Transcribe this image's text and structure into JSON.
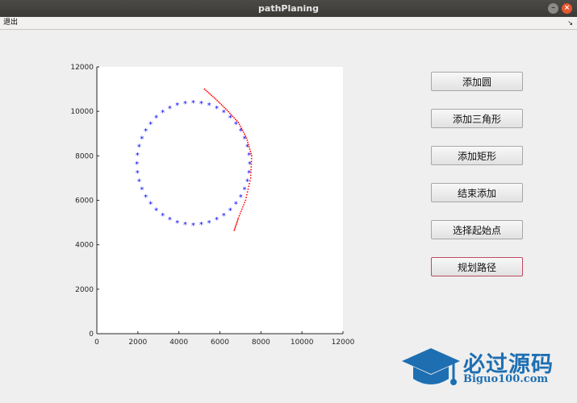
{
  "window": {
    "title": "pathPlaning",
    "close_glyph": "×",
    "min_glyph": "–"
  },
  "menubar": {
    "exit_label": "退出",
    "arrow_glyph": "↘"
  },
  "buttons": {
    "add_circle": "添加圆",
    "add_triangle": "添加三角形",
    "add_rectangle": "添加矩形",
    "finish_add": "结束添加",
    "select_start": "选择起始点",
    "plan_path": "规划路径"
  },
  "chart_data": {
    "type": "scatter",
    "xlim": [
      0,
      12000
    ],
    "ylim": [
      0,
      12000
    ],
    "x_ticks": [
      0,
      2000,
      4000,
      6000,
      8000,
      10000,
      12000
    ],
    "y_ticks": [
      0,
      2000,
      4000,
      6000,
      8000,
      10000,
      12000
    ],
    "grid": false,
    "obstacle_circle": {
      "center": [
        4700,
        7650
      ],
      "radius": 2750,
      "marker": "*",
      "color": "#0000ff",
      "point_count": 44
    },
    "path": {
      "color": "#ff0000",
      "points": [
        [
          5250,
          11000
        ],
        [
          5800,
          10550
        ],
        [
          6350,
          10050
        ],
        [
          6900,
          9500
        ],
        [
          7300,
          8800
        ],
        [
          7550,
          8000
        ],
        [
          7500,
          7000
        ],
        [
          7250,
          6000
        ],
        [
          6900,
          5200
        ],
        [
          6700,
          4650
        ]
      ]
    }
  },
  "watermark": {
    "title": "必过源码",
    "subtitle": "Biguo100.com",
    "icon": "graduation-cap-icon"
  }
}
